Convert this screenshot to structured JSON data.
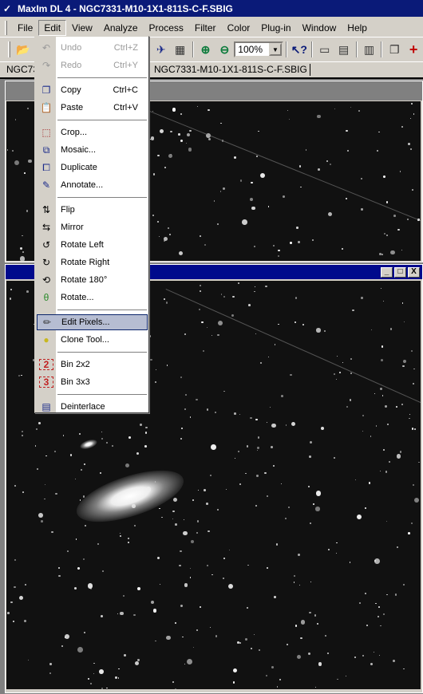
{
  "window": {
    "title": "MaxIm DL 4 - NGC7331-M10-1X1-811S-C-F.SBIG",
    "app_icon": "maxim-logo-icon"
  },
  "menubar": {
    "items": [
      {
        "label": "File"
      },
      {
        "label": "Edit",
        "active": true
      },
      {
        "label": "View"
      },
      {
        "label": "Analyze"
      },
      {
        "label": "Process"
      },
      {
        "label": "Filter"
      },
      {
        "label": "Color"
      },
      {
        "label": "Plug-in"
      },
      {
        "label": "Window"
      },
      {
        "label": "Help"
      }
    ]
  },
  "toolbar": {
    "zoom_value": "100%",
    "buttons": [
      "open-folder-icon",
      "telescope-icon",
      "settings-screen-icon",
      "zoom-in-icon",
      "zoom-out-icon",
      "context-help-icon",
      "ruler-icon",
      "stacked-icon",
      "chart-doc-icon",
      "copy-doc-icon",
      "crosshair-icon"
    ]
  },
  "tabs": [
    {
      "label": "NGC73"
    },
    {
      "label": "NGC7331-M10-1X1-811S-C-F.SBIG"
    }
  ],
  "bottom_window": {
    "controls": {
      "minimize": "_",
      "maximize": "□",
      "close": "X"
    }
  },
  "edit_menu": {
    "items": [
      {
        "label": "Undo",
        "shortcut": "Ctrl+Z",
        "icon": "undo-icon",
        "disabled": true
      },
      {
        "label": "Redo",
        "shortcut": "Ctrl+Y",
        "icon": "redo-icon",
        "disabled": true
      },
      {
        "separator": true
      },
      {
        "label": "Copy",
        "shortcut": "Ctrl+C",
        "icon": "copy-icon"
      },
      {
        "label": "Paste",
        "shortcut": "Ctrl+V",
        "icon": "paste-icon"
      },
      {
        "separator": true
      },
      {
        "label": "Crop...",
        "icon": "crop-icon"
      },
      {
        "label": "Mosaic...",
        "icon": "mosaic-icon"
      },
      {
        "label": "Duplicate",
        "icon": "duplicate-icon"
      },
      {
        "label": "Annotate...",
        "icon": "annotate-icon"
      },
      {
        "separator": true
      },
      {
        "label": "Flip",
        "icon": "flip-icon"
      },
      {
        "label": "Mirror",
        "icon": "mirror-icon"
      },
      {
        "label": "Rotate Left",
        "icon": "rotate-left-icon"
      },
      {
        "label": "Rotate Right",
        "icon": "rotate-right-icon"
      },
      {
        "label": "Rotate 180°",
        "icon": "rotate-180-icon"
      },
      {
        "label": "Rotate...",
        "icon": "rotate-arbitrary-icon"
      },
      {
        "separator": true
      },
      {
        "label": "Edit Pixels...",
        "icon": "pencil-icon",
        "highlighted": true
      },
      {
        "label": "Clone Tool...",
        "icon": "clone-icon"
      },
      {
        "separator": true
      },
      {
        "label": "Bin 2x2",
        "icon": "bin-2-icon"
      },
      {
        "label": "Bin 3x3",
        "icon": "bin-3-icon"
      },
      {
        "separator": true
      },
      {
        "label": "Deinterlace",
        "icon": "deinterlace-icon"
      }
    ]
  }
}
